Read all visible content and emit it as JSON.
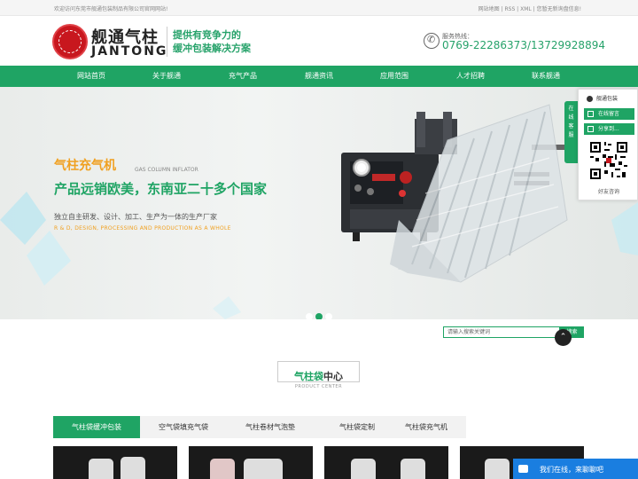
{
  "topbar": {
    "welcome": "欢迎访问东莞市舰通包装制品有限公司官网网站!",
    "links": "网站地图 | RSS | XML | 您暂无新询盘信息!"
  },
  "header": {
    "logo_cn": "舰通气柱",
    "logo_en": "JANTONG",
    "slogan_line1": "提供有竞争力的",
    "slogan_line2": "缓冲包装解决方案",
    "hotline_label": "服务热线：",
    "hotline_number": "0769-22286373/13729928894"
  },
  "nav": {
    "items": [
      "网站首页",
      "关于舰通",
      "充气产品",
      "舰通资讯",
      "应用范围",
      "人才招聘",
      "联系舰通"
    ]
  },
  "banner": {
    "title": "气柱充气机",
    "title_en": "GAS COLUMN INFLATOR",
    "subtitle": "产品远销欧美，东南亚二十多个国家",
    "desc": "独立自主研发、设计、加工、生产为一体的生产厂家",
    "desc_en": "R & D, DESIGN, PROCESSING AND PRODUCTION AS A WHOLE",
    "slide_count": 3,
    "active_slide": 2
  },
  "float_panel": {
    "side_tab": "在线客服",
    "qq_label": "舰通包装",
    "message_label": "在线留言",
    "share_label": "分享到...",
    "friend_label": "好友咨询"
  },
  "search": {
    "placeholder": "请输入搜索关键词",
    "button": "搜索"
  },
  "section": {
    "title_green": "气柱袋",
    "title_dark": "中心",
    "title_en": "PRODUCT CENTER"
  },
  "tabs": {
    "items": [
      "气柱袋缓冲包装",
      "空气袋填充气袋",
      "气柱卷材气泡垫",
      "气柱袋定制",
      "气柱袋充气机"
    ],
    "active_index": 0
  },
  "chat": {
    "label": "我们在线，来聊聊吧"
  },
  "colors": {
    "brand_green": "#1fa464",
    "accent_orange": "#f0a020",
    "chat_blue": "#1a7ee0"
  }
}
